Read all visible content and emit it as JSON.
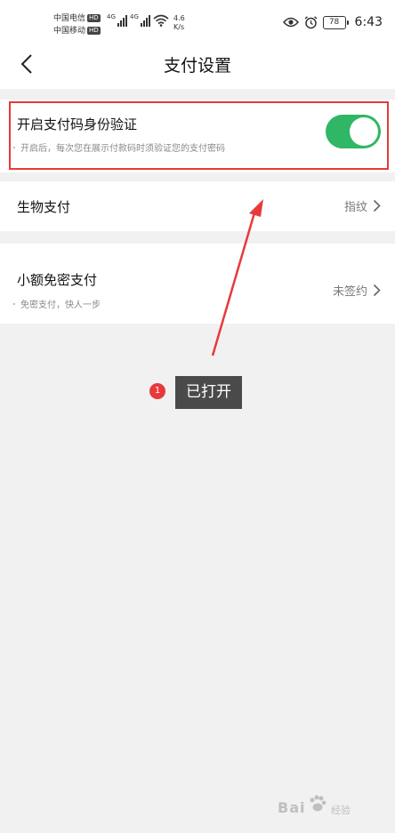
{
  "status_bar": {
    "carrier_1": "中国电信",
    "carrier_2": "中国移动",
    "hd_badge": "HD",
    "network_tag": "4G",
    "net_speed_value": "4.6",
    "net_speed_unit": "K/s",
    "battery_level": "78",
    "time": "6:43"
  },
  "header": {
    "title": "支付设置"
  },
  "pay_code_verification": {
    "title": "开启支付码身份验证",
    "description": "开启后，每次您在展示付款码时须验证您的支付密码",
    "enabled": true
  },
  "biometric_payment": {
    "title": "生物支付",
    "value": "指纹"
  },
  "small_amount_payment": {
    "title": "小额免密支付",
    "description": "免密支付，快人一步",
    "value": "未签约"
  },
  "annotation": {
    "step_number": "1",
    "label": "已打开"
  },
  "watermark": {
    "text": "Bai",
    "suffix": "经验"
  },
  "colors": {
    "toggle_on": "#2fb765",
    "highlight": "#e8393b",
    "background": "#f1f1f1"
  }
}
